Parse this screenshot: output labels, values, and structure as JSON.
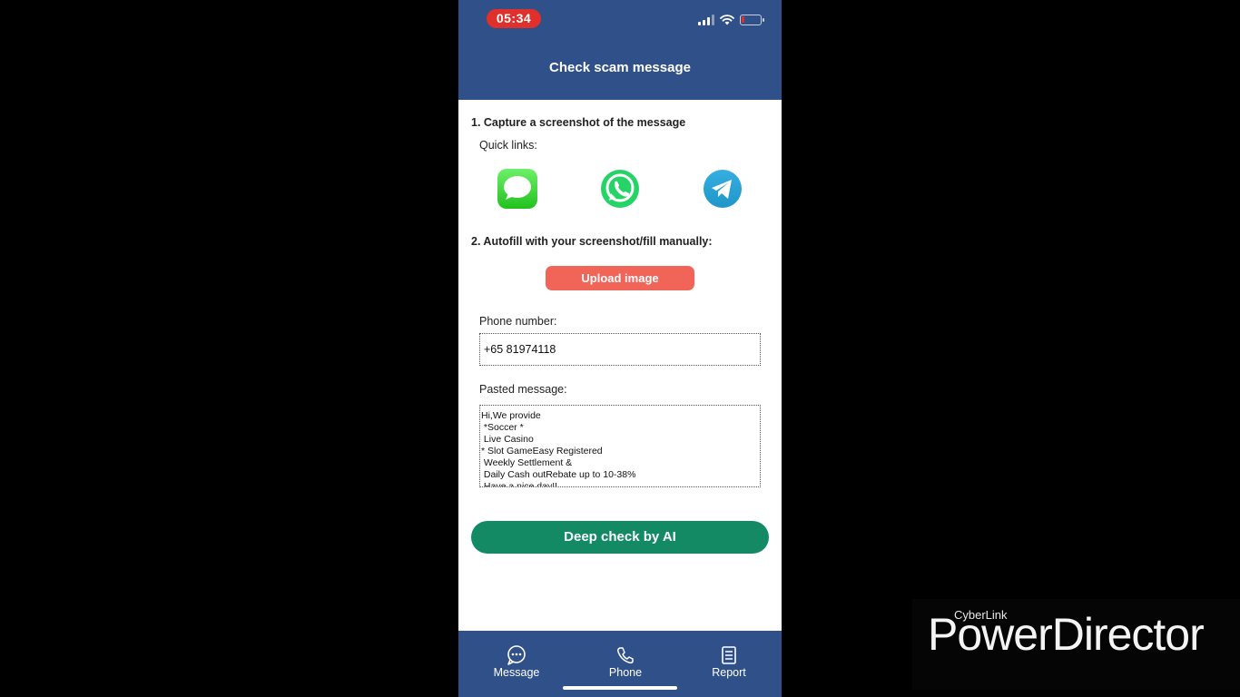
{
  "status_bar": {
    "time": "05:34"
  },
  "header": {
    "title": "Check scam message"
  },
  "step1": {
    "title": "1. Capture a screenshot of the message",
    "quick_links_label": "Quick links:",
    "quick_links": [
      "messages-app-icon",
      "whatsapp-icon",
      "telegram-icon"
    ]
  },
  "step2": {
    "title": "2. Autofill with your screenshot/fill manually:",
    "upload_label": "Upload image"
  },
  "form": {
    "phone_label": "Phone number:",
    "phone_value": "+65 81974118",
    "message_label": "Pasted message:",
    "message_value": "Hi,We provide\n *Soccer *\n Live Casino\n* Slot GameEasy Registered\n Weekly Settlement &\n Daily Cash outRebate up to 10-38%\n Have a nice day!!"
  },
  "action": {
    "deep_check_label": "Deep check by AI"
  },
  "bottom_nav": {
    "items": [
      {
        "label": "Message",
        "icon": "chat-bubble-icon"
      },
      {
        "label": "Phone",
        "icon": "phone-icon"
      },
      {
        "label": "Report",
        "icon": "document-icon"
      }
    ]
  },
  "watermark": {
    "brand_small": "CyberLink",
    "brand_big": "PowerDirector"
  },
  "colors": {
    "header_bg": "#30508a",
    "upload_button": "#f16559",
    "ai_button": "#138a63",
    "time_pill": "#e0302b"
  }
}
